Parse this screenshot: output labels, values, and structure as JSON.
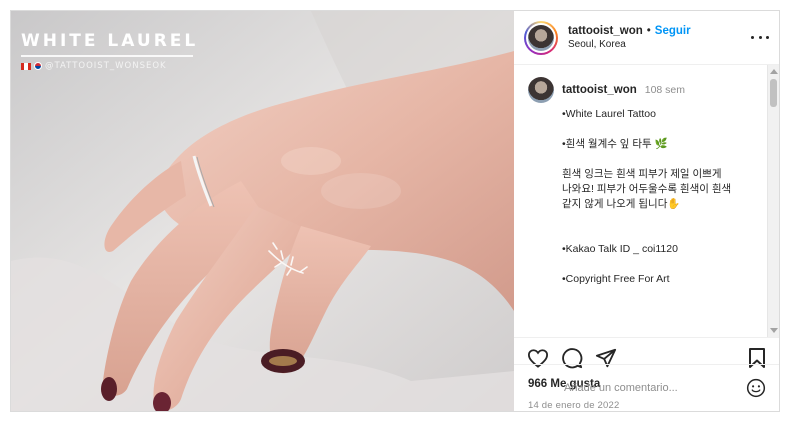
{
  "photo": {
    "watermark_title": "WHITE LAUREL",
    "watermark_handle": "@TATTOOIST_WONSEOK",
    "alt_icons": [
      "canada-flag-icon",
      "korea-flag-icon"
    ]
  },
  "header": {
    "username": "tattooist_won",
    "separator": "•",
    "follow_label": "Seguir",
    "location": "Seoul, Korea"
  },
  "caption": {
    "username": "tattooist_won",
    "time_ago": "108 sem",
    "lines": [
      "•White Laurel Tattoo",
      "•흰색 월계수 잎 타투",
      "흰색 잉크는 흰색 피부가 제일 이쁘게\n나와요! 피부가 어두울수록 흰색이 흰색\n같지 않게 나오게 됩니다",
      "•Kakao Talk ID _ coi1120",
      "•Copyright Free For Art"
    ],
    "leaf_emoji": "🌿",
    "hand_emoji": "✋"
  },
  "stats": {
    "likes": "966 Me gusta",
    "date": "14 de enero de 2022"
  },
  "comment_box": {
    "placeholder": "Añade un comentario..."
  },
  "colors": {
    "accent": "#0095f6",
    "text": "#262626",
    "muted": "#8e8e8e",
    "border": "#dbdbdb"
  },
  "icons": [
    "more-options-icon",
    "heart-icon",
    "comment-icon",
    "share-icon",
    "bookmark-icon",
    "emoji-icon"
  ]
}
